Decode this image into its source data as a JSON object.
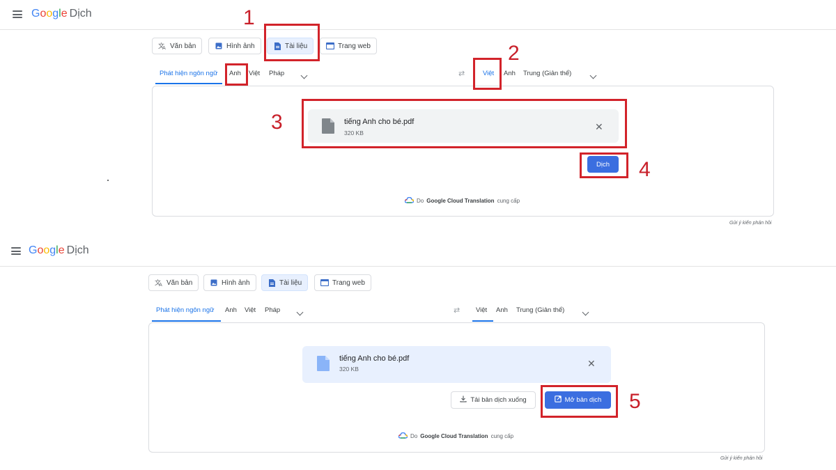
{
  "panels": [
    {
      "app_name": "Dịch",
      "logo_letters": [
        "G",
        "o",
        "o",
        "g",
        "l",
        "e"
      ],
      "modes": [
        "Văn bản",
        "Hình ảnh",
        "Tài liệu",
        "Trang web"
      ],
      "source_langs": [
        "Phát hiện ngôn ngữ",
        "Anh",
        "Việt",
        "Pháp"
      ],
      "target_langs": [
        "Việt",
        "Anh",
        "Trung (Giản thể)"
      ],
      "file_name": "tiếng Anh cho bé.pdf",
      "file_size": "320 KB",
      "translate_label": "Dịch",
      "credit_prefix": "Do",
      "credit_brand": "Google Cloud Translation",
      "credit_suffix": "cung cấp",
      "feedback": "Gửi ý kiến phản hồi"
    },
    {
      "app_name": "Dịch",
      "logo_letters": [
        "G",
        "o",
        "o",
        "g",
        "l",
        "e"
      ],
      "modes": [
        "Văn bản",
        "Hình ảnh",
        "Tài liệu",
        "Trang web"
      ],
      "source_langs": [
        "Phát hiện ngôn ngữ",
        "Anh",
        "Việt",
        "Pháp"
      ],
      "target_langs": [
        "Việt",
        "Anh",
        "Trung (Giản thể)"
      ],
      "file_name": "tiếng Anh cho bé.pdf",
      "file_size": "320 KB",
      "download_label": "Tải bản dịch xuống",
      "open_label": "Mở bản dịch",
      "credit_prefix": "Do",
      "credit_brand": "Google Cloud Translation",
      "credit_suffix": "cung cấp",
      "feedback": "Gửi ý kiến phản hồi"
    }
  ],
  "step_numbers": [
    "1",
    "2",
    "3",
    "4",
    "5"
  ],
  "colors": {
    "accent": "#1a73e8",
    "primary_button": "#3b6ee0",
    "annotation_red": "#d2232a"
  }
}
